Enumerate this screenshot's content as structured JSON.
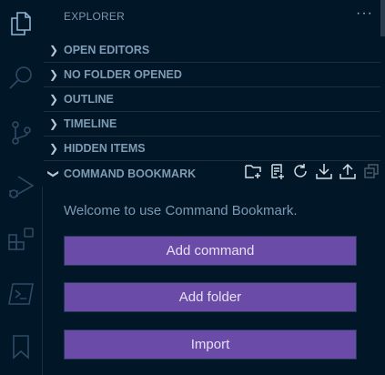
{
  "activity_bar": {
    "items": [
      {
        "name": "explorer",
        "icon": "files-icon",
        "active": true
      },
      {
        "name": "search",
        "icon": "search-icon"
      },
      {
        "name": "source-control",
        "icon": "source-control-icon"
      },
      {
        "name": "run-debug",
        "icon": "run-debug-icon"
      },
      {
        "name": "extensions",
        "icon": "extensions-icon"
      },
      {
        "name": "terminal",
        "icon": "terminal-icon"
      },
      {
        "name": "bookmark",
        "icon": "bookmark-icon"
      }
    ]
  },
  "explorer": {
    "title": "EXPLORER",
    "more": "···",
    "sections": [
      {
        "label": "OPEN EDITORS",
        "expanded": false
      },
      {
        "label": "NO FOLDER OPENED",
        "expanded": false
      },
      {
        "label": "OUTLINE",
        "expanded": false
      },
      {
        "label": "TIMELINE",
        "expanded": false
      },
      {
        "label": "HIDDEN ITEMS",
        "expanded": false
      },
      {
        "label": "COMMAND BOOKMARK",
        "expanded": true
      }
    ],
    "toolbar": [
      "new-folder-icon",
      "add-command-icon",
      "refresh-icon",
      "download-icon",
      "upload-icon",
      "collapse-all-icon"
    ]
  },
  "bookmark": {
    "welcome": "Welcome to use Command Bookmark.",
    "buttons": {
      "add_command": "Add command",
      "add_folder": "Add folder",
      "import": "Import"
    }
  },
  "colors": {
    "background": "#011627",
    "button": "#6a4ca8"
  }
}
